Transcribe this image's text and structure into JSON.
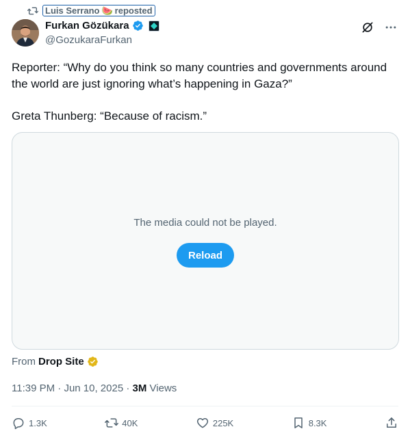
{
  "repost": {
    "user": "Luis Serrano",
    "emoji": "🍉",
    "label": "reposted",
    "icon": "retweet-icon"
  },
  "author": {
    "name": "Furkan Gözükara",
    "handle": "@GozukaraFurkan",
    "verified_color": "#1d9bf0",
    "icon": "verified-badge-icon"
  },
  "post": {
    "paragraphs": [
      "Reporter: “Why do you think so many countries and governments around the world are just ignoring what’s happening in Gaza?”",
      "Greta Thunberg: “Because of racism.”"
    ]
  },
  "media": {
    "message": "The media could not be played.",
    "reload_label": "Reload"
  },
  "source": {
    "prefix": "From",
    "name": "Drop Site",
    "badge_color": "#e2b719"
  },
  "meta": {
    "time": "11:39 PM",
    "sep1": " · ",
    "date": "Jun 10, 2025",
    "sep2": " · ",
    "views": "3M",
    "views_label": " Views"
  },
  "actions": [
    {
      "name": "reply",
      "count": "1.3K",
      "icon": "reply-icon"
    },
    {
      "name": "repost",
      "count": "40K",
      "icon": "retweet-icon"
    },
    {
      "name": "like",
      "count": "225K",
      "icon": "heart-icon"
    },
    {
      "name": "bookmark",
      "count": "8.3K",
      "icon": "bookmark-icon"
    },
    {
      "name": "share",
      "count": "",
      "icon": "share-icon"
    }
  ],
  "colors": {
    "accent": "#1d9bf0",
    "muted": "#536471",
    "text": "#0f1419",
    "border": "#cfd9de"
  }
}
